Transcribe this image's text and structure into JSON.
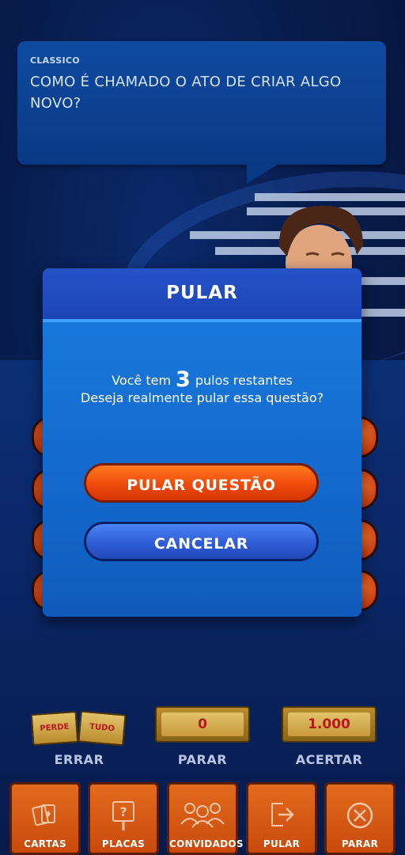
{
  "question": {
    "category": "CLASSICO",
    "text": "COMO É CHAMADO O ATO DE CRIAR ALGO NOVO?"
  },
  "modal": {
    "title": "PULAR",
    "message_prefix": "Você tem",
    "skips_remaining": "3",
    "message_suffix": "pulos restantes",
    "message_line2": "Deseja realmente pular essa questão?",
    "skip_button": "PULAR QUESTÃO",
    "cancel_button": "CANCELAR"
  },
  "money": {
    "lose": {
      "word1": "PERDE",
      "word2": "TUDO",
      "label": "ERRAR"
    },
    "stop": {
      "value": "0",
      "label": "PARAR"
    },
    "correct": {
      "value": "1.000",
      "label": "ACERTAR"
    }
  },
  "toolbar": {
    "items": [
      {
        "label": "CARTAS",
        "icon": "cards-icon"
      },
      {
        "label": "PLACAS",
        "icon": "question-sign-icon"
      },
      {
        "label": "CONVIDADOS",
        "icon": "guests-icon"
      },
      {
        "label": "PULAR",
        "icon": "skip-icon"
      },
      {
        "label": "PARAR",
        "icon": "stop-icon"
      }
    ]
  },
  "colors": {
    "accent_orange": "#ef4a0b",
    "accent_blue": "#2e5cd6",
    "modal_blue": "#1469cc",
    "money_red": "#b9171c"
  }
}
